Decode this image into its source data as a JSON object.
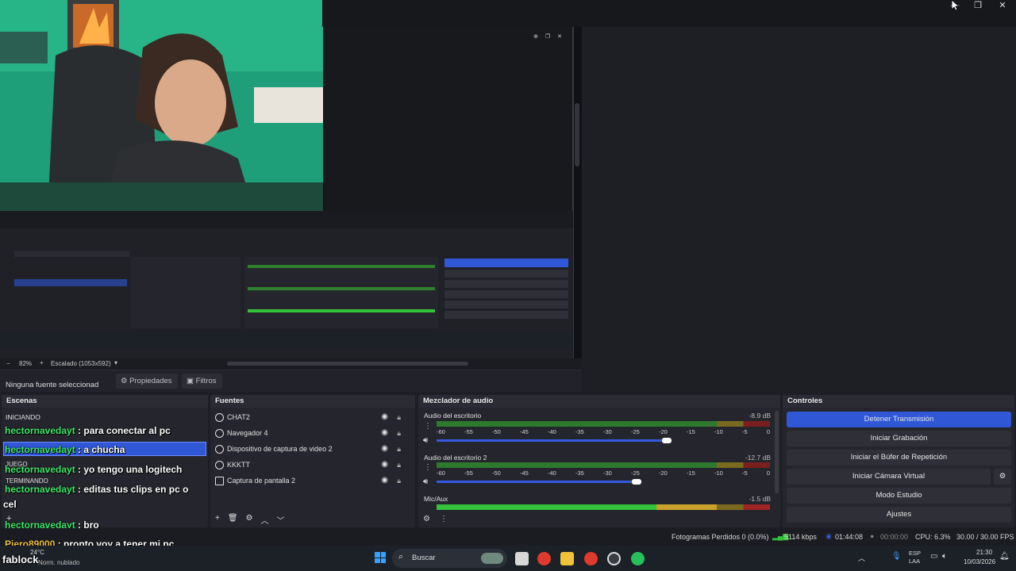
{
  "window": {
    "controls": [
      "—",
      "❐",
      "✕"
    ]
  },
  "preview": {
    "nested_controls": [
      "⊕",
      "❐",
      "✕"
    ],
    "zoom": "82%",
    "zoom_plus": "+",
    "scale_label": "Escalado (1053x592)"
  },
  "properties_bar": {
    "no_selection": "Ninguna fuente seleccionad",
    "properties_btn": "Propiedades",
    "filters_btn": "Filtros"
  },
  "scenes": {
    "title": "Escenas",
    "items": [
      "INICIANDO",
      "JUEGO",
      "TERMINANDO"
    ]
  },
  "sources": {
    "title": "Fuentes",
    "items": [
      "CHAT2",
      "Navegador 4",
      "Dispositivo de captura de video 2",
      "KKKTT",
      "Captura de pantalla 2"
    ]
  },
  "mixer": {
    "title": "Mezclador de audio",
    "channels": [
      {
        "name": "Audio del escritorio",
        "db": "-8.9 dB",
        "level": 0.69
      },
      {
        "name": "Audio del escritorio 2",
        "db": "-12.7 dB",
        "level": 0.6
      },
      {
        "name": "Mic/Aux",
        "db": "-1.5 dB",
        "level": 0.67
      }
    ],
    "ticks": [
      "-60",
      "-55",
      "-50",
      "-45",
      "-40",
      "-35",
      "-30",
      "-25",
      "-20",
      "-15",
      "-10",
      "-5",
      "0"
    ]
  },
  "controls": {
    "title": "Controles",
    "buttons": [
      "Detener Transmisión",
      "Iniciar Grabación",
      "Iniciar el Búfer de Repetición",
      "Iniciar Cámara Virtual",
      "Modo Estudio",
      "Ajustes"
    ]
  },
  "chat": [
    {
      "user": "hectornavedayt",
      "msg": " : para conectar al pc"
    },
    {
      "user": "hectornavedayt",
      "msg": " : a chucha"
    },
    {
      "user": "hectornavedayt",
      "msg": " : yo tengo una logitech"
    },
    {
      "user": "hectornavedayt",
      "msg": " : editas tus clips en pc o"
    },
    {
      "user": "",
      "msg": "cel"
    },
    {
      "user": "hectornavedayt",
      "msg": " : bro"
    },
    {
      "user": "Piero89000",
      "msg": " : pronto voy a tener mi pc"
    },
    {
      "user": "",
      "msg": "fablock"
    }
  ],
  "status": {
    "dropped": "Fotogramas Perdidos 0 (0.0%)",
    "kbps": "5114 kbps",
    "live_time": "01:44:08",
    "rec_time": "00:00:00",
    "cpu": "CPU: 6.3%",
    "fps": "30.00 / 30.00 FPS"
  },
  "taskbar": {
    "weather_temp": "24°C",
    "weather_desc": "Norm. nublado",
    "search": "Buscar",
    "lang": "ESP",
    "lang2": "LAA",
    "time": "21:30",
    "date": "10/03/2026"
  },
  "colors": {
    "accent": "#2f57d6",
    "meter_green": "#33c23a",
    "meter_yellow": "#c9a22a",
    "meter_red": "#c22a2a",
    "chat_user": "#3ee86a"
  }
}
